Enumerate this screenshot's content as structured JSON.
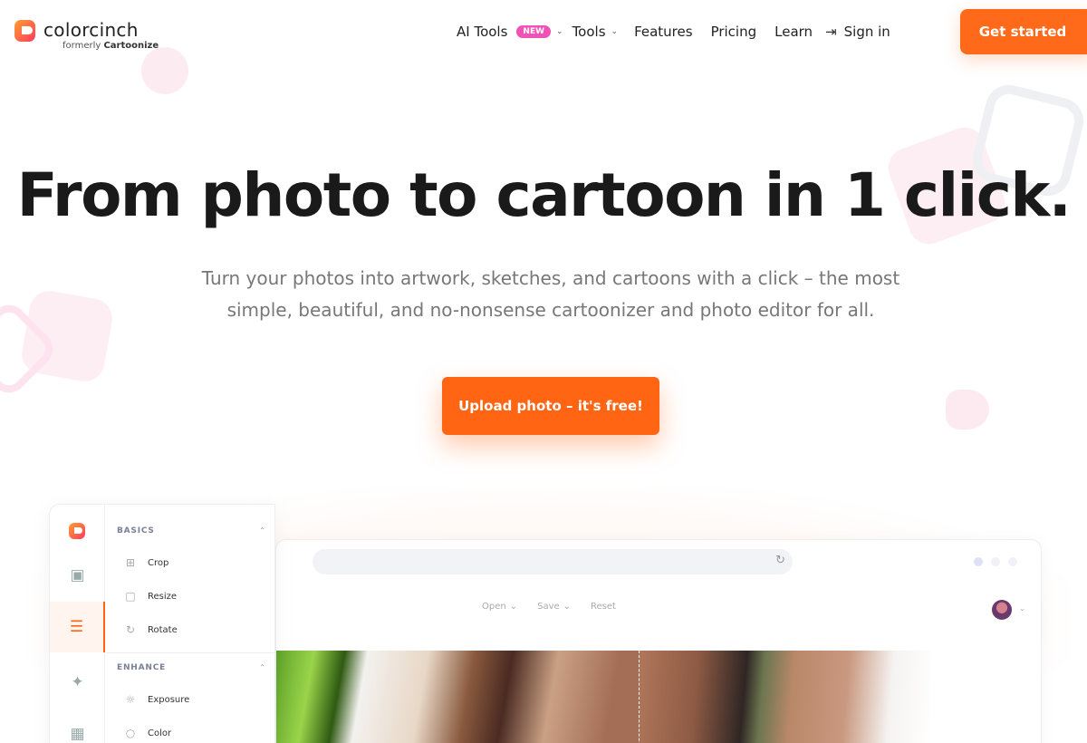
{
  "brand": {
    "name": "colorcinch",
    "sub_prefix": "formerly",
    "sub_name": "Cartoonize"
  },
  "nav": {
    "items": [
      {
        "label": "AI Tools",
        "badge": "NEW",
        "dropdown": true
      },
      {
        "label": "Tools",
        "dropdown": true
      },
      {
        "label": "Features"
      },
      {
        "label": "Pricing"
      },
      {
        "label": "Learn"
      }
    ],
    "signin": "Sign in",
    "cta": "Get started"
  },
  "hero": {
    "title": "From photo to cartoon in 1 click.",
    "subtitle": "Turn your photos into artwork, sketches, and cartoons with a click – the most simple, beautiful, and no-nonsense cartoonizer and photo editor for all.",
    "cta": "Upload photo – it's free!"
  },
  "app": {
    "toolbar": [
      "Open",
      "Save",
      "Reset"
    ],
    "sections": [
      {
        "title": "BASICS",
        "tools": [
          {
            "label": "Crop",
            "icon": "crop-icon"
          },
          {
            "label": "Resize",
            "icon": "resize-icon"
          },
          {
            "label": "Rotate",
            "icon": "rotate-icon"
          }
        ]
      },
      {
        "title": "ENHANCE",
        "tools": [
          {
            "label": "Exposure",
            "icon": "sun-icon"
          },
          {
            "label": "Color",
            "icon": "droplet-icon"
          }
        ]
      }
    ]
  },
  "colors": {
    "accent": "#ff6512",
    "badge": "#f052b6",
    "text": "#1a1a1a",
    "muted": "#777777"
  }
}
